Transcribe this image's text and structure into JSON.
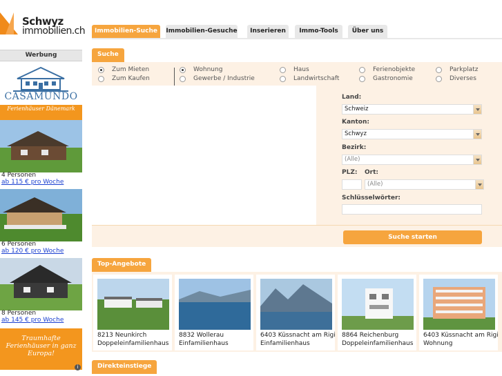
{
  "logo": {
    "line1": "Schwyz",
    "line2": "immobilien.ch"
  },
  "nav": {
    "tabs": [
      "Immobilien-Suche",
      "Immobilien-Gesuche",
      "Inserieren",
      "Immo-Tools",
      "Über uns"
    ],
    "active": "Immobilien-Suche"
  },
  "sidebar": {
    "werbung": "Werbung",
    "ad": {
      "brand": "CASAMUNDO",
      "tagline": "Ferienhäuser Dänemark",
      "offers": [
        {
          "persons": "4 Personen",
          "price": "ab 115 € pro Woche"
        },
        {
          "persons": "6 Personen",
          "price": "ab 120 € pro Woche"
        },
        {
          "persons": "8 Personen",
          "price": "ab 145 € pro Woche"
        }
      ],
      "footer": "Traumhafte Ferienhäuser in ganz Europa!"
    }
  },
  "search": {
    "header": "Suche",
    "modes": [
      {
        "label": "Zum Mieten",
        "checked": true
      },
      {
        "label": "Zum Kaufen",
        "checked": false
      }
    ],
    "types": [
      {
        "label": "Wohnung",
        "checked": true
      },
      {
        "label": "Gewerbe / Industrie",
        "checked": false
      },
      {
        "label": "Haus",
        "checked": false
      },
      {
        "label": "Landwirtschaft",
        "checked": false
      },
      {
        "label": "Ferienobjekte",
        "checked": false
      },
      {
        "label": "Gastronomie",
        "checked": false
      },
      {
        "label": "Parkplatz",
        "checked": false
      },
      {
        "label": "Diverses",
        "checked": false
      }
    ],
    "land_label": "Land:",
    "land_value": "Schweiz",
    "kanton_label": "Kanton:",
    "kanton_value": "Schwyz",
    "bezirk_label": "Bezirk:",
    "bezirk_value": "(Alle)",
    "plz_label": "PLZ:",
    "ort_label": "Ort:",
    "ort_value": "(Alle)",
    "keywords_label": "Schlüsselwörter:",
    "submit": "Suche starten"
  },
  "top": {
    "header": "Top-Angebote",
    "items": [
      {
        "loc": "8213 Neunkirch",
        "type": "Doppeleinfamilienhaus"
      },
      {
        "loc": "8832 Wollerau",
        "type": "Einfamilienhaus"
      },
      {
        "loc": "6403 Küssnacht am Rigi",
        "type": "Einfamilienhaus"
      },
      {
        "loc": "8864 Reichenburg",
        "type": "Doppeleinfamilienhaus"
      },
      {
        "loc": "6403 Küssnacht am Rigi",
        "type": "Wohnung"
      }
    ]
  },
  "direkt": {
    "header": "Direkteinstiege"
  },
  "colors": {
    "accent": "#f6a53e",
    "panel": "#fdf1e4",
    "link": "#1a3fd0"
  }
}
